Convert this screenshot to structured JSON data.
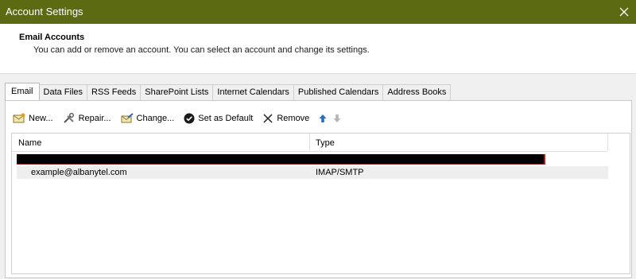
{
  "window": {
    "title": "Account Settings"
  },
  "header": {
    "title": "Email Accounts",
    "description": "You can add or remove an account. You can select an account and change its settings."
  },
  "tabs": [
    {
      "label": "Email",
      "active": true
    },
    {
      "label": "Data Files"
    },
    {
      "label": "RSS Feeds"
    },
    {
      "label": "SharePoint Lists"
    },
    {
      "label": "Internet Calendars"
    },
    {
      "label": "Published Calendars"
    },
    {
      "label": "Address Books"
    }
  ],
  "toolbar": {
    "new_label": "New...",
    "repair_label": "Repair...",
    "change_label": "Change...",
    "set_default_label": "Set as Default",
    "remove_label": "Remove"
  },
  "list": {
    "columns": {
      "name": "Name",
      "type": "Type"
    },
    "rows": [
      {
        "name": "example@albanytel.com",
        "type": "IMAP/SMTP"
      }
    ]
  },
  "colors": {
    "titlebar": "#5c6a12",
    "panel_bg": "#f0f0f0",
    "selected_row": "#eeeeee",
    "arrow_blue": "#2b6cc4"
  }
}
